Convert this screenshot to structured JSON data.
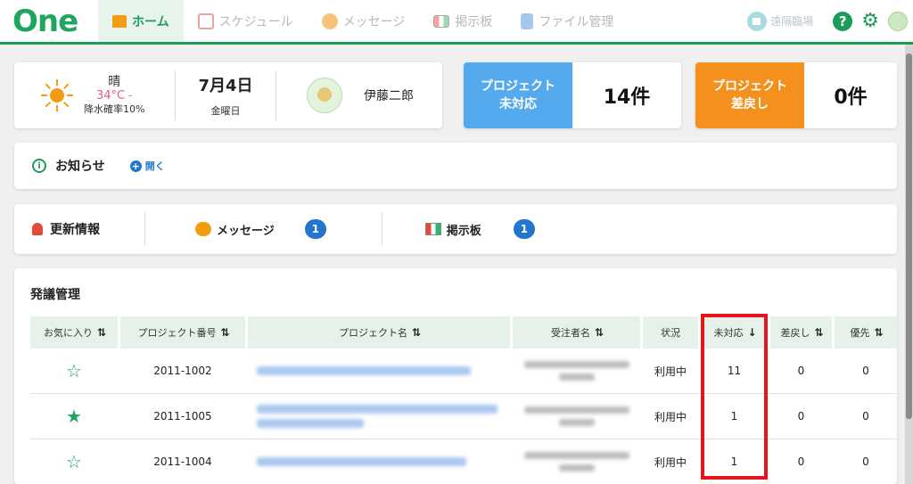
{
  "nav": {
    "logo": "One",
    "items": [
      {
        "label": "ホーム",
        "icon": "home-icon",
        "active": true
      },
      {
        "label": "スケジュール",
        "icon": "calendar-icon",
        "active": false
      },
      {
        "label": "メッセージ",
        "icon": "message-icon",
        "active": false
      },
      {
        "label": "掲示板",
        "icon": "bulletin-board-icon",
        "active": false
      },
      {
        "label": "ファイル管理",
        "icon": "file-icon",
        "active": false
      }
    ],
    "remote_label": "遠隔臨場",
    "help_symbol": "?"
  },
  "info": {
    "weather_condition": "晴",
    "temp_high": "34°C",
    "temp_low": "-",
    "rain_chance": "降水確率10%",
    "date": "7月4日",
    "weekday": "金曜日",
    "user_name": "伊藤二郎"
  },
  "project_cards": [
    {
      "label": "プロジェクト\n未対応",
      "count": "14件",
      "color": "#55aaee"
    },
    {
      "label": "プロジェクト\n差戻し",
      "count": "0件",
      "color": "#f4911e"
    }
  ],
  "notice": {
    "title": "お知らせ",
    "open_label": "開く"
  },
  "updates": {
    "title": "更新情報",
    "items": [
      {
        "label": "メッセージ",
        "count": "1"
      },
      {
        "label": "掲示板",
        "count": "1"
      }
    ]
  },
  "orders": {
    "title": "発議管理",
    "columns": {
      "favorite": "お気に入り",
      "project_no": "プロジェクト番号",
      "project_name": "プロジェクト名",
      "contractor": "受注者名",
      "status": "状況",
      "unhandled": "未対応",
      "returned": "差戻し",
      "priority": "優先"
    },
    "sort_symbol": "⇅",
    "sort_desc_symbol": "↓",
    "rows": [
      {
        "favorite": false,
        "project_no": "2011-1002",
        "status": "利用中",
        "unhandled": "11",
        "returned": "0",
        "priority": "0"
      },
      {
        "favorite": true,
        "project_no": "2011-1005",
        "status": "利用中",
        "unhandled": "1",
        "returned": "0",
        "priority": "0"
      },
      {
        "favorite": false,
        "project_no": "2011-1004",
        "status": "利用中",
        "unhandled": "1",
        "returned": "0",
        "priority": "0"
      }
    ]
  },
  "colors": {
    "brand": "#1c9c5a",
    "highlight_border": "#e8141b",
    "badge": "#2277cc"
  }
}
